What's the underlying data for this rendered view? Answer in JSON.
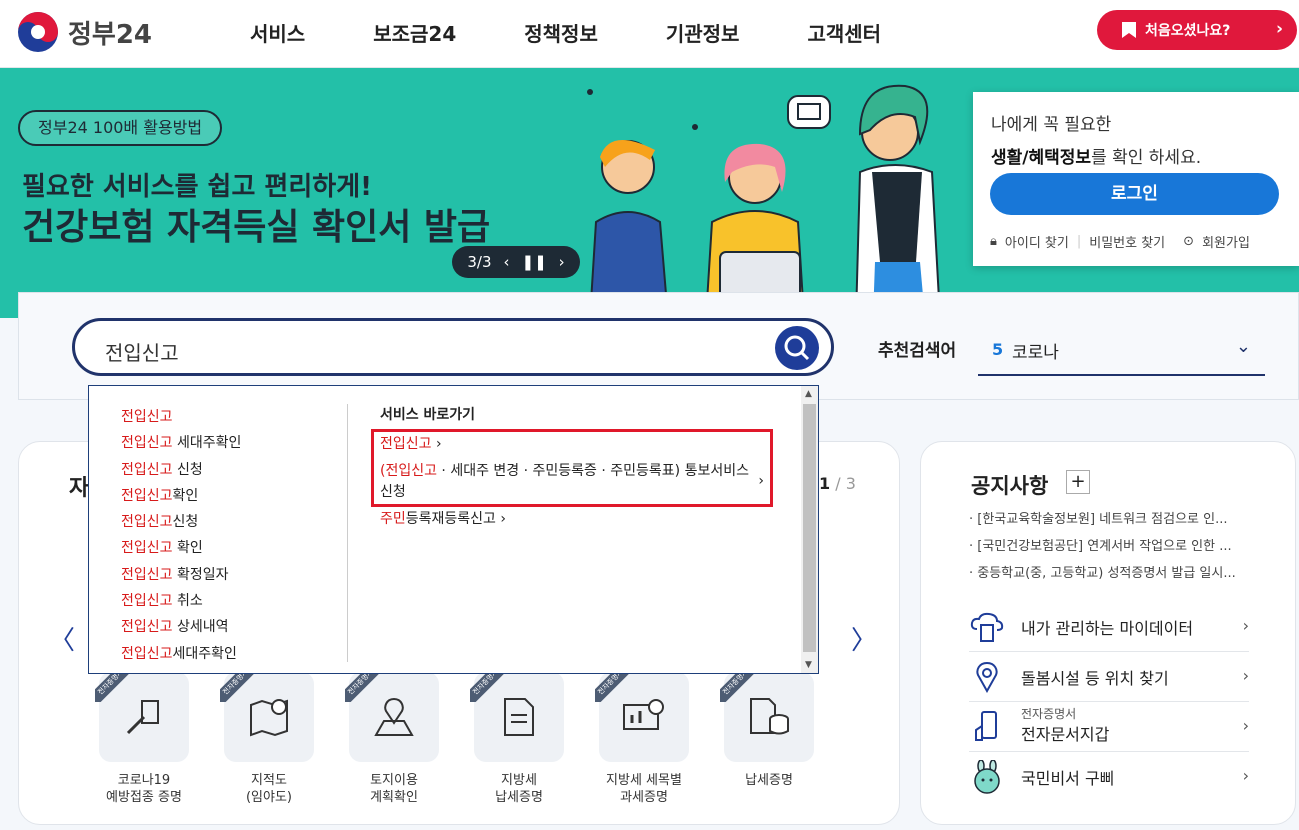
{
  "header": {
    "logo_text": "정부24",
    "nav": [
      "서비스",
      "보조금24",
      "정책정보",
      "기관정보",
      "고객센터"
    ],
    "first_visit_button": "처음오셨나요?"
  },
  "banner": {
    "pill": "정부24 100배 활용방법",
    "headline1": "필요한 서비스를 쉽고 편리하게!",
    "headline2": "건강보험 자격득실 확인서 발급",
    "pager": "3/3"
  },
  "login_card": {
    "line1": "나에게 꼭 필요한",
    "line2_bold": "생활/혜택정보",
    "line2_rest": "를 확인 하세요.",
    "login_button": "로그인",
    "find_id": "아이디 찾기",
    "find_pw": "비밀번호 찾기",
    "signup": "회원가입"
  },
  "search": {
    "value": "전입신고",
    "rec_label": "추천검색어",
    "rec_number": "5",
    "rec_text": "코로나"
  },
  "dropdown": {
    "suggestions": [
      {
        "hl": "전입신고",
        "rest": ""
      },
      {
        "hl": "전입신고",
        "rest": " 세대주확인"
      },
      {
        "hl": "전입신고",
        "rest": " 신청"
      },
      {
        "hl": "전입신고",
        "rest": "확인"
      },
      {
        "hl": "전입신고",
        "rest": "신청"
      },
      {
        "hl": "전입신고",
        "rest": " 확인"
      },
      {
        "hl": "전입신고",
        "rest": " 확정일자"
      },
      {
        "hl": "전입신고",
        "rest": " 취소"
      },
      {
        "hl": "전입신고",
        "rest": " 상세내역"
      },
      {
        "hl": "전입신고",
        "rest": "세대주확인"
      }
    ],
    "shortcuts_title": "서비스 바로가기",
    "shortcut1_hl": "전입신고",
    "shortcut2_hl": "(전입신고",
    "shortcut2_rest": " · 세대주 변경 · 주민등록증 · 주민등록표) 통보서비스신청",
    "shortcut3_hl": "주민",
    "shortcut3_rest": "등록재등록신고"
  },
  "services_card": {
    "title_fragment": "자",
    "page_current": "1",
    "page_total": "3",
    "badge": "전자증명서",
    "tiles": [
      {
        "label": "코로나19\n예방접종 증명",
        "icon": "syringe-icon"
      },
      {
        "label": "지적도\n(임야도)",
        "icon": "map-icon"
      },
      {
        "label": "토지이용\n계획확인",
        "icon": "location-map-icon"
      },
      {
        "label": "지방세\n납세증명",
        "icon": "document-icon"
      },
      {
        "label": "지방세 세목별\n과세증명",
        "icon": "chart-board-icon"
      },
      {
        "label": "납세증명",
        "icon": "database-document-icon"
      }
    ]
  },
  "notice_card": {
    "title": "공지사항",
    "plus": "+",
    "notices": [
      "[한국교육학술정보원] 네트워크 점검으로 인...",
      "[국민건강보험공단] 연계서버 작업으로 인한 ...",
      "중등학교(중, 고등학교) 성적증명서 발급 일시..."
    ],
    "services": [
      {
        "text": "내가 관리하는 마이데이터",
        "sub": "",
        "icon": "cloud-server-icon"
      },
      {
        "text": "돌봄시설 등 위치 찾기",
        "sub": "",
        "icon": "location-pin-icon"
      },
      {
        "text": "전자문서지갑",
        "sub": "전자증명서",
        "icon": "phone-wallet-icon"
      },
      {
        "text": "국민비서 구삐",
        "sub": "",
        "icon": "rabbit-mascot-icon"
      }
    ]
  }
}
